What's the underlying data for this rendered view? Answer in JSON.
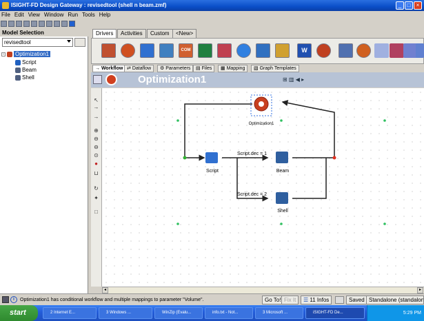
{
  "window": {
    "title": "ISIGHT-FD Design Gateway : revisedtool (shell n beam.zmf)"
  },
  "menu": [
    "File",
    "Edit",
    "View",
    "Window",
    "Run",
    "Tools",
    "Help"
  ],
  "left_panel": {
    "header": "Model Selection",
    "model_value": "revisedtool",
    "tree": [
      {
        "label": "Optimization1",
        "icon": "optimization-icon"
      },
      {
        "label": "Script",
        "icon": "script-icon"
      },
      {
        "label": "Beam",
        "icon": "beam-icon"
      },
      {
        "label": "Shell",
        "icon": "shell-icon"
      }
    ]
  },
  "doc_tabs": [
    "Drivers",
    "Activities",
    "Custom",
    "<New>"
  ],
  "component_icons": [
    "do-loop",
    "optimization",
    "script",
    "table",
    "com",
    "excel",
    "calculator",
    "data-exchanger",
    "simcode",
    "ftp",
    "word",
    "loop",
    "mathcad",
    "optimization-2",
    "brush",
    "chart",
    "arrows",
    "connect"
  ],
  "subtabs": [
    "Workflow",
    "Dataflow",
    "Parameters",
    "Files",
    "Mapping",
    "Graph Templates"
  ],
  "header": {
    "title": "Optimization1"
  },
  "workflow": {
    "nodes": {
      "root": "Optimization1",
      "script": "Script",
      "beam": "Beam",
      "shell": "Shell"
    },
    "conditions": {
      "beam": "Script.dec = 1",
      "shell": "Script.dec = 2"
    }
  },
  "status": {
    "message": "Optimization1 has conditional workflow and multiple mappings to parameter \"Volume\".",
    "goto": "Go To!",
    "fix": "Fix It",
    "infos": "11 Infos",
    "saved": "Saved",
    "mode": "Standalone (standalone"
  },
  "taskbar": {
    "start": "start",
    "tasks": [
      "2 Internet E...",
      "3 Windows ...",
      "WinZip (Evalu...",
      "info.txt - Not...",
      "3 Microsoft ...",
      "iSIGHT-FD De..."
    ],
    "clock": "5:29 PM"
  },
  "colors": {
    "title_bar": "#0a4ec8",
    "header_band": "#b7c3d6",
    "selection": "#316ac5",
    "start_green": "#2f8a2f",
    "canvas_grid": "#b8b8b8",
    "workflow_green": "#30b030",
    "workflow_red": "#e03020",
    "taskbar_blue": "#245edb"
  }
}
